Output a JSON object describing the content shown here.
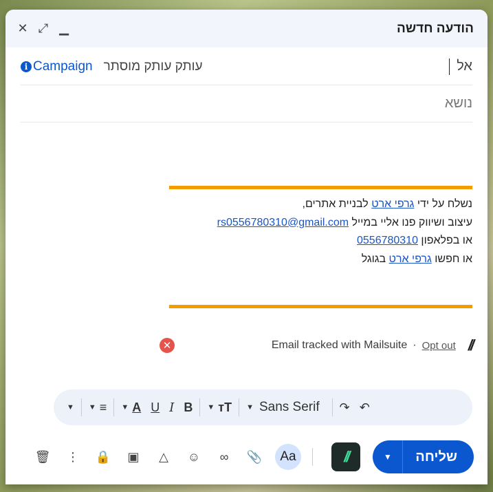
{
  "window": {
    "title": "הודעה חדשה",
    "close_icon": "close-icon",
    "fullscreen_icon": "expand-icon",
    "minimize_icon": "minimize-icon"
  },
  "to_row": {
    "label": "אל",
    "cc_links": "עותק עותק מוסתר",
    "campaign": "Campaign"
  },
  "subject": {
    "placeholder": "נושא",
    "value": ""
  },
  "signature": {
    "line1_pre": "נשלח על ידי ",
    "line1_link": "גרפי ארט",
    "line1_post": " לבניית אתרים,",
    "line2_pre": "עיצוב ושיווק פנו אליי במייל ",
    "line2_link": "rs0556780310@gmail.com",
    "line3_pre": "או בפלאפון ",
    "line3_link": "0556780310",
    "line4_pre": "או חפשו ",
    "line4_link": "גרפי ארט",
    "line4_post": " בגוגל",
    "accent_color": "#f39c00"
  },
  "tracker": {
    "text": "Email tracked with Mailsuite",
    "dot": "·",
    "opt_out": "Opt out",
    "logo": "//"
  },
  "format_bar": {
    "font": "Sans Serif"
  },
  "actions": {
    "send_label": "שליחה",
    "mailsuite_logo": "//",
    "aa_label": "Aa",
    "send_color": "#0b57d0"
  }
}
